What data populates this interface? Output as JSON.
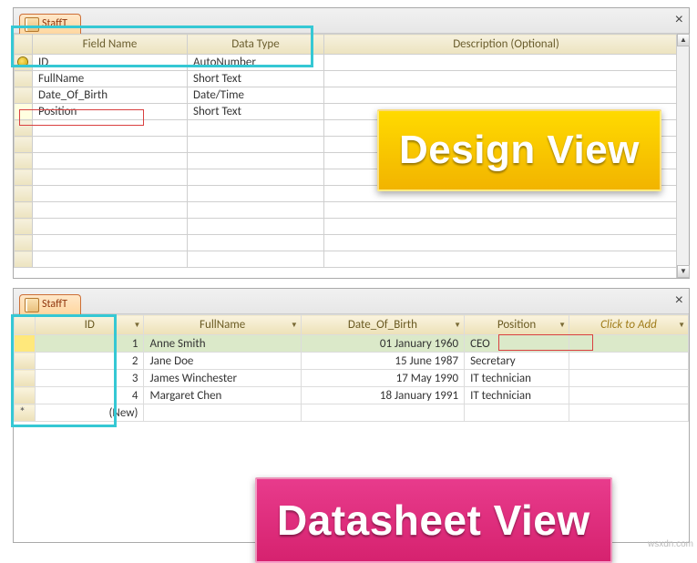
{
  "top": {
    "tab_title": "StaffT",
    "headers": {
      "field": "Field Name",
      "type": "Data Type",
      "desc": "Description (Optional)"
    },
    "rows": [
      {
        "field": "ID",
        "type": "AutoNumber",
        "pk": true
      },
      {
        "field": "FullName",
        "type": "Short Text"
      },
      {
        "field": "Date_Of_Birth",
        "type": "Date/Time"
      },
      {
        "field": "Position",
        "type": "Short Text"
      }
    ],
    "label": "Design View"
  },
  "bottom": {
    "tab_title": "StaffT",
    "headers": {
      "id": "ID",
      "name": "FullName",
      "dob": "Date_Of_Birth",
      "pos": "Position",
      "add": "Click to Add"
    },
    "rows": [
      {
        "id": "1",
        "name": "Anne Smith",
        "dob": "01 January 1960",
        "pos": "CEO",
        "selected": true
      },
      {
        "id": "2",
        "name": "Jane Doe",
        "dob": "15 June 1987",
        "pos": "Secretary"
      },
      {
        "id": "3",
        "name": "James Winchester",
        "dob": "17 May 1990",
        "pos": "IT technician"
      },
      {
        "id": "4",
        "name": "Margaret Chen",
        "dob": "18 January 1991",
        "pos": "IT technician"
      }
    ],
    "new_row_label": "(New)",
    "label": "Datasheet View"
  },
  "watermark": "wsxdn.com"
}
